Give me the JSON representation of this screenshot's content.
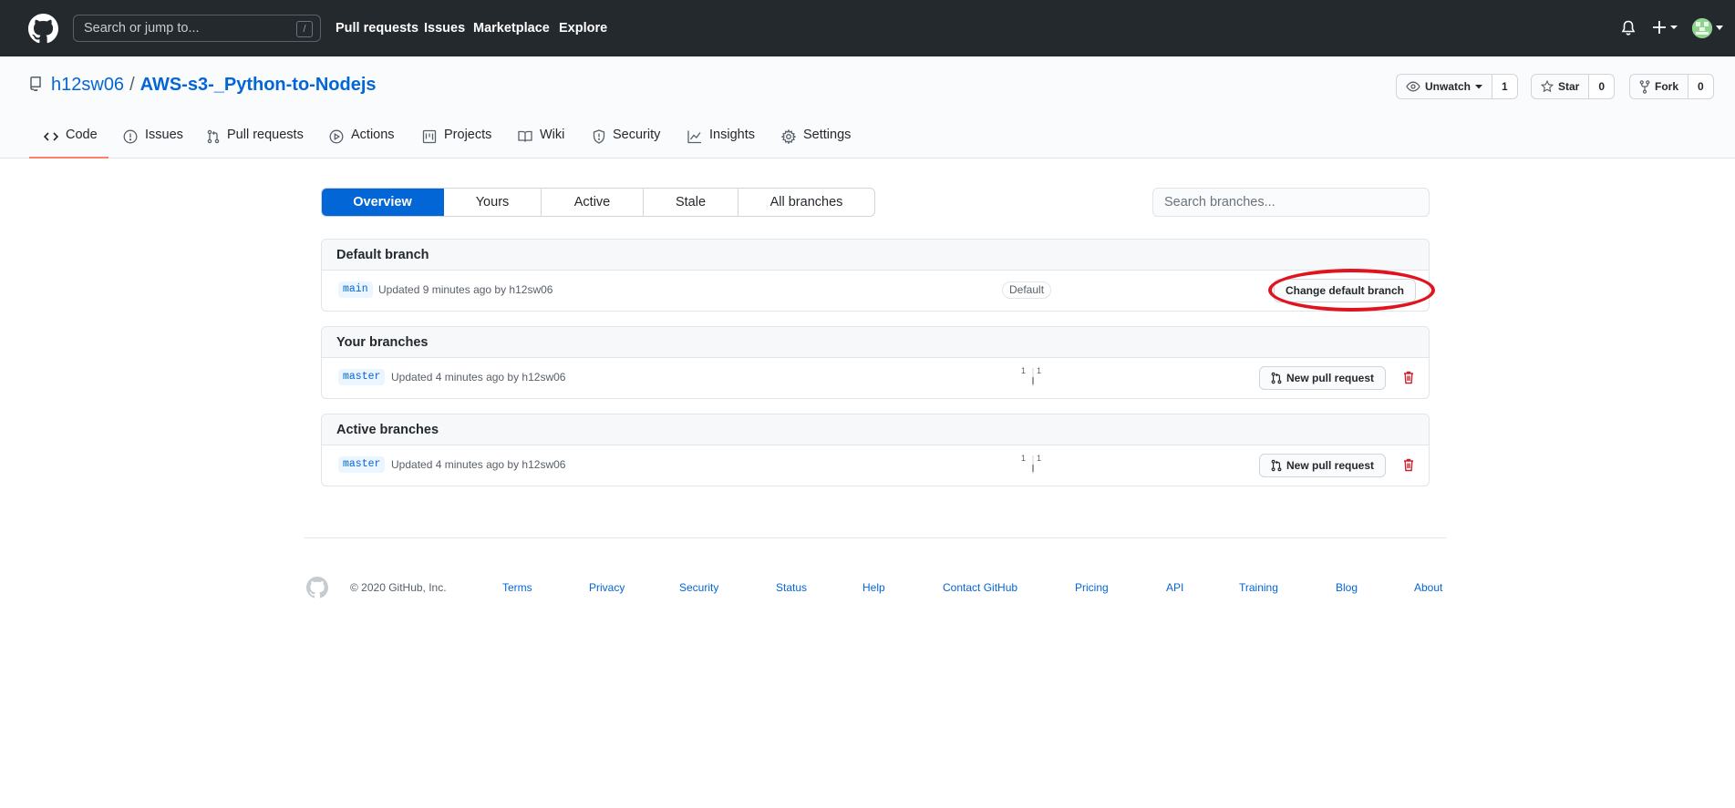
{
  "header": {
    "search_placeholder": "Search or jump to...",
    "search_shortcut": "/",
    "nav": [
      "Pull requests",
      "Issues",
      "Marketplace",
      "Explore"
    ]
  },
  "repo": {
    "owner": "h12sw06",
    "separator": "/",
    "name": "AWS-s3-_Python-to-Nodejs",
    "watch_label": "Unwatch",
    "watch_count": "1",
    "star_label": "Star",
    "star_count": "0",
    "fork_label": "Fork",
    "fork_count": "0"
  },
  "tabs": [
    "Code",
    "Issues",
    "Pull requests",
    "Actions",
    "Projects",
    "Wiki",
    "Security",
    "Insights",
    "Settings"
  ],
  "branch_filters": {
    "items": [
      "Overview",
      "Yours",
      "Active",
      "Stale",
      "All branches"
    ],
    "selected": "Overview",
    "search_placeholder": "Search branches..."
  },
  "sections": {
    "default": {
      "title": "Default branch",
      "branch": "main",
      "meta": "Updated 9 minutes ago by h12sw06",
      "label": "Default",
      "button": "Change default branch"
    },
    "yours": {
      "title": "Your branches",
      "branch": "master",
      "meta": "Updated 4 minutes ago by h12sw06",
      "behind": "1",
      "ahead": "1",
      "button": "New pull request"
    },
    "active": {
      "title": "Active branches",
      "branch": "master",
      "meta": "Updated 4 minutes ago by h12sw06",
      "behind": "1",
      "ahead": "1",
      "button": "New pull request"
    }
  },
  "footer": {
    "copyright": "© 2020 GitHub, Inc.",
    "links": [
      "Terms",
      "Privacy",
      "Security",
      "Status",
      "Help",
      "Contact GitHub",
      "Pricing",
      "API",
      "Training",
      "Blog",
      "About"
    ]
  },
  "colors": {
    "header_bg": "#24292e",
    "link_blue": "#0366d6",
    "selected_tab_underline": "#f9826c",
    "delete_red": "#cb2431",
    "annotation_red": "#e0141e"
  }
}
